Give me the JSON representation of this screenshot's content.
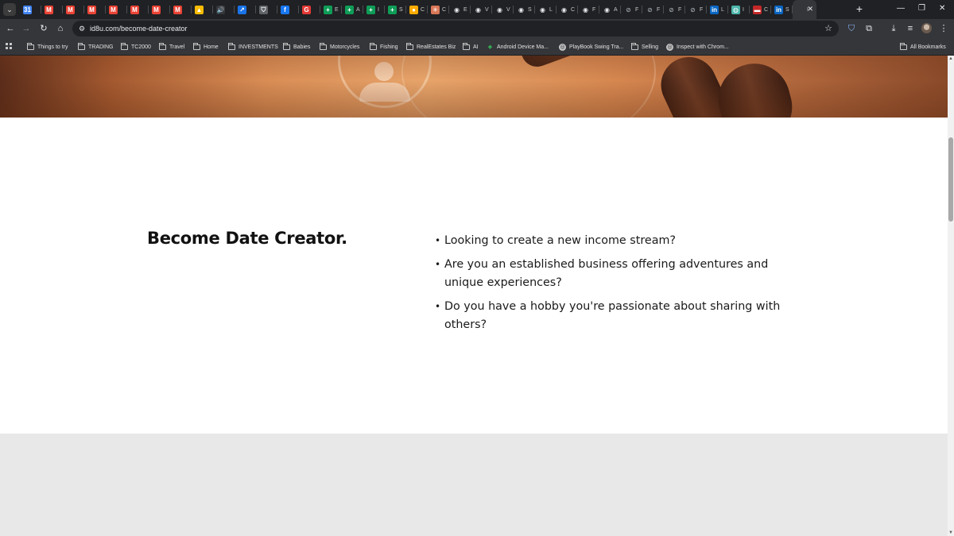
{
  "tabs": [
    {
      "icon": "calendar-icon",
      "color": "#4285f4",
      "glyph": "31",
      "letter": ""
    },
    {
      "icon": "gmail-icon",
      "color": "#ea4335",
      "glyph": "M",
      "letter": ""
    },
    {
      "icon": "gmail-icon",
      "color": "#ea4335",
      "glyph": "M",
      "letter": ""
    },
    {
      "icon": "gmail-icon",
      "color": "#ea4335",
      "glyph": "M",
      "letter": ""
    },
    {
      "icon": "gmail-icon",
      "color": "#ea4335",
      "glyph": "M",
      "letter": ""
    },
    {
      "icon": "gmail-icon",
      "color": "#ea4335",
      "glyph": "M",
      "letter": ""
    },
    {
      "icon": "gmail-icon",
      "color": "#ea4335",
      "glyph": "M",
      "letter": ""
    },
    {
      "icon": "gmail-icon",
      "color": "#ea4335",
      "glyph": "M",
      "letter": ""
    },
    {
      "icon": "google-drive-icon",
      "color": "#fbbc04",
      "glyph": "▲",
      "letter": ""
    },
    {
      "icon": "audio-icon",
      "color": "#35363a",
      "glyph": "🔊",
      "letter": ""
    },
    {
      "icon": "chart-icon",
      "color": "#1a73e8",
      "glyph": "↗",
      "letter": ""
    },
    {
      "icon": "shield-icon",
      "color": "#5f6368",
      "glyph": "⛉",
      "letter": ""
    },
    {
      "icon": "facebook-icon",
      "color": "#1877f2",
      "glyph": "f",
      "letter": ""
    },
    {
      "icon": "app-icon",
      "color": "#e53935",
      "glyph": "G",
      "letter": ""
    },
    {
      "icon": "sheets-icon",
      "color": "#0f9d58",
      "glyph": "+",
      "letter": "E"
    },
    {
      "icon": "sheets-icon",
      "color": "#0f9d58",
      "glyph": "+",
      "letter": "A"
    },
    {
      "icon": "sheets-icon",
      "color": "#0f9d58",
      "glyph": "+",
      "letter": "I"
    },
    {
      "icon": "sheets-icon",
      "color": "#0f9d58",
      "glyph": "+",
      "letter": "S"
    },
    {
      "icon": "coin-icon",
      "color": "#f9ab00",
      "glyph": "●",
      "letter": "C"
    },
    {
      "icon": "claude-icon",
      "color": "#d97757",
      "glyph": "✳",
      "letter": "C"
    },
    {
      "icon": "github-icon",
      "color": "#e8eaed",
      "glyph": "◉",
      "letter": "E"
    },
    {
      "icon": "github-icon",
      "color": "#e8eaed",
      "glyph": "◉",
      "letter": "V"
    },
    {
      "icon": "github-icon",
      "color": "#e8eaed",
      "glyph": "◉",
      "letter": "V"
    },
    {
      "icon": "github-icon",
      "color": "#e8eaed",
      "glyph": "◉",
      "letter": "S"
    },
    {
      "icon": "github-icon",
      "color": "#e8eaed",
      "glyph": "◉",
      "letter": "L"
    },
    {
      "icon": "github-icon",
      "color": "#e8eaed",
      "glyph": "◉",
      "letter": "C"
    },
    {
      "icon": "github-icon",
      "color": "#e8eaed",
      "glyph": "◉",
      "letter": "F"
    },
    {
      "icon": "github-icon",
      "color": "#e8eaed",
      "glyph": "◉",
      "letter": "A"
    },
    {
      "icon": "globe-icon",
      "color": "#9aa0a6",
      "glyph": "⊘",
      "letter": "F"
    },
    {
      "icon": "globe-icon",
      "color": "#9aa0a6",
      "glyph": "⊘",
      "letter": "F"
    },
    {
      "icon": "globe-icon",
      "color": "#9aa0a6",
      "glyph": "⊘",
      "letter": "F"
    },
    {
      "icon": "globe-icon",
      "color": "#9aa0a6",
      "glyph": "⊘",
      "letter": "F"
    },
    {
      "icon": "linkedin-icon",
      "color": "#0a66c2",
      "glyph": "in",
      "letter": "L"
    },
    {
      "icon": "earth-icon",
      "color": "#4db6ac",
      "glyph": "◍",
      "letter": "I"
    },
    {
      "icon": "bars-icon",
      "color": "#c62828",
      "glyph": "▬",
      "letter": "C"
    },
    {
      "icon": "linkedin-icon",
      "color": "#0a66c2",
      "glyph": "in",
      "letter": "S"
    },
    {
      "icon": "page-icon",
      "color": "#35363a",
      "glyph": "",
      "letter": "I",
      "active": true
    }
  ],
  "toolbar": {
    "url": "id8u.com/become-date-creator"
  },
  "bookmarks": [
    {
      "label": "Things to try",
      "type": "folder"
    },
    {
      "label": "TRADING",
      "type": "folder"
    },
    {
      "label": "TC2000",
      "type": "folder"
    },
    {
      "label": "Travel",
      "type": "folder"
    },
    {
      "label": "Home",
      "type": "folder"
    },
    {
      "label": "INVESTMENTS",
      "type": "folder"
    },
    {
      "label": "Babies",
      "type": "folder"
    },
    {
      "label": "Motorcycles",
      "type": "folder"
    },
    {
      "label": "Fishing",
      "type": "folder"
    },
    {
      "label": "RealEstates Biz",
      "type": "folder"
    },
    {
      "label": "AI",
      "type": "folder"
    },
    {
      "label": "Android Device Ma...",
      "type": "link",
      "icon": "android-icon"
    },
    {
      "label": "PlayBook Swing Tra...",
      "type": "link",
      "icon": "globe-icon"
    },
    {
      "label": "Selling",
      "type": "folder"
    },
    {
      "label": "Inspect with Chrom...",
      "type": "link",
      "icon": "globe-icon"
    }
  ],
  "all_bookmarks_label": "All Bookmarks",
  "main": {
    "title": "Become Date Creator.",
    "bullets": [
      "Looking to create a new income stream?",
      "Are you an established business offering adventures and unique experiences?",
      "Do you have a hobby you're passionate about sharing with others?"
    ]
  },
  "colors": {
    "browser_dark": "#202124",
    "toolbar": "#35363a",
    "page_bg": "#ffffff",
    "section_gray": "#e8e8e8",
    "hero_orange": "#e7a46a"
  }
}
